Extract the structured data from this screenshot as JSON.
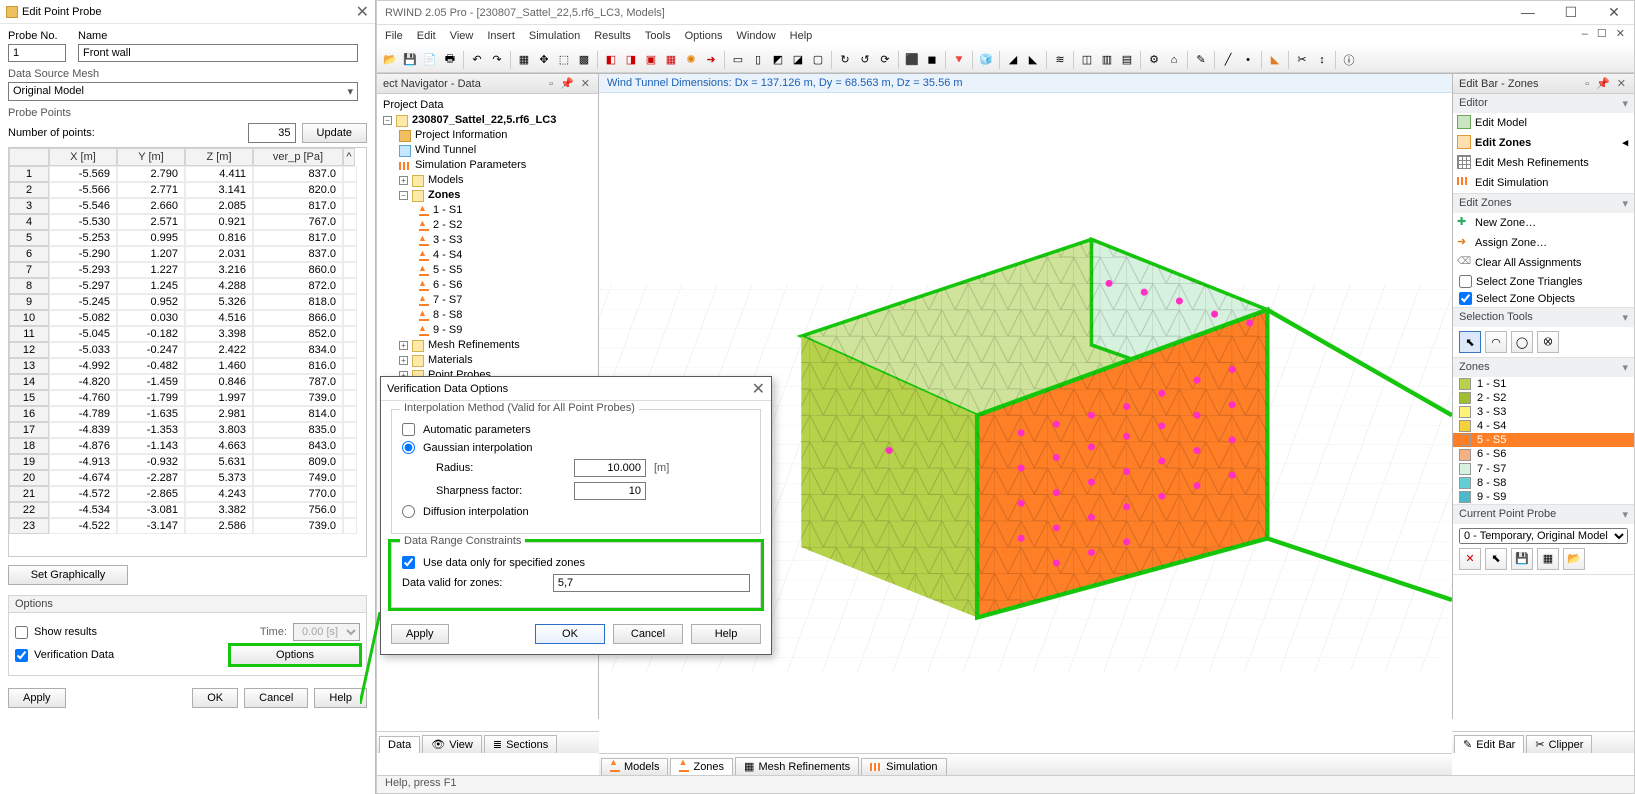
{
  "main": {
    "title": "RWIND 2.05 Pro - [230807_Sattel_22,5.rf6_LC3, Models]",
    "menus": [
      "File",
      "Edit",
      "View",
      "Insert",
      "Simulation",
      "Results",
      "Tools",
      "Options",
      "Window",
      "Help"
    ],
    "banner": "Wind Tunnel Dimensions: Dx = 137.126 m, Dy = 68.563 m, Dz = 35.56 m",
    "status": "Help, press F1"
  },
  "navigator": {
    "title": "ect Navigator - Data",
    "project_header": "Project Data",
    "root": "230807_Sattel_22,5.rf6_LC3",
    "items": [
      "Project Information",
      "Wind Tunnel",
      "Simulation Parameters",
      "Models",
      "Zones"
    ],
    "zones": [
      "1 - S1",
      "2 - S2",
      "3 - S3",
      "4 - S4",
      "5 - S5",
      "6 - S6",
      "7 - S7",
      "8 - S8",
      "9 - S9"
    ],
    "tail": [
      "Mesh Refinements",
      "Materials",
      "Point Probes"
    ],
    "bottom_tabs": [
      "Data",
      "View",
      "Sections"
    ]
  },
  "viewport_tabs": [
    "Models",
    "Zones",
    "Mesh Refinements",
    "Simulation"
  ],
  "editbar": {
    "title": "Edit Bar - Zones",
    "editor_title": "Editor",
    "editor": [
      "Edit Model",
      "Edit Zones",
      "Edit Mesh Refinements",
      "Edit Simulation"
    ],
    "zones_title": "Edit Zones",
    "zone_actions": [
      "New Zone…",
      "Assign Zone…",
      "Clear All Assignments"
    ],
    "zone_checks": [
      "Select Zone Triangles",
      "Select Zone Objects"
    ],
    "sel_title": "Selection Tools",
    "zl_title": "Zones",
    "zone_list": [
      {
        "label": "1 - S1",
        "color": "#b6d24b"
      },
      {
        "label": "2 - S2",
        "color": "#9fbf2e"
      },
      {
        "label": "3 - S3",
        "color": "#fff27a"
      },
      {
        "label": "4 - S4",
        "color": "#f5d23a"
      },
      {
        "label": "5 - S5",
        "color": "#ff7f27"
      },
      {
        "label": "6 - S6",
        "color": "#f4b183"
      },
      {
        "label": "7 - S7",
        "color": "#d6f1de"
      },
      {
        "label": "8 - S8",
        "color": "#61d0d4"
      },
      {
        "label": "9 - S9",
        "color": "#4bb9c9"
      }
    ],
    "probe_title": "Current Point Probe",
    "probe_value": "0 - Temporary, Original Model",
    "bottom_tabs": [
      "Edit Bar",
      "Clipper"
    ]
  },
  "probe_dlg": {
    "title": "Edit Point Probe",
    "no_lbl": "Probe No.",
    "no_val": "1",
    "name_lbl": "Name",
    "name_val": "Front wall",
    "src_lbl": "Data Source Mesh",
    "src_val": "Original Model",
    "pts_lbl": "Probe Points",
    "numpts_lbl": "Number of points:",
    "numpts_val": "35",
    "update": "Update",
    "cols": [
      "",
      "X [m]",
      "Y [m]",
      "Z [m]",
      "ver_p [Pa]",
      "^"
    ],
    "rows": [
      [
        "1",
        "-5.569",
        "2.790",
        "4.411",
        "837.0"
      ],
      [
        "2",
        "-5.566",
        "2.771",
        "3.141",
        "820.0"
      ],
      [
        "3",
        "-5.546",
        "2.660",
        "2.085",
        "817.0"
      ],
      [
        "4",
        "-5.530",
        "2.571",
        "0.921",
        "767.0"
      ],
      [
        "5",
        "-5.253",
        "0.995",
        "0.816",
        "817.0"
      ],
      [
        "6",
        "-5.290",
        "1.207",
        "2.031",
        "837.0"
      ],
      [
        "7",
        "-5.293",
        "1.227",
        "3.216",
        "860.0"
      ],
      [
        "8",
        "-5.297",
        "1.245",
        "4.288",
        "872.0"
      ],
      [
        "9",
        "-5.245",
        "0.952",
        "5.326",
        "818.0"
      ],
      [
        "10",
        "-5.082",
        "0.030",
        "4.516",
        "866.0"
      ],
      [
        "11",
        "-5.045",
        "-0.182",
        "3.398",
        "852.0"
      ],
      [
        "12",
        "-5.033",
        "-0.247",
        "2.422",
        "834.0"
      ],
      [
        "13",
        "-4.992",
        "-0.482",
        "1.460",
        "816.0"
      ],
      [
        "14",
        "-4.820",
        "-1.459",
        "0.846",
        "787.0"
      ],
      [
        "15",
        "-4.760",
        "-1.799",
        "1.997",
        "739.0"
      ],
      [
        "16",
        "-4.789",
        "-1.635",
        "2.981",
        "814.0"
      ],
      [
        "17",
        "-4.839",
        "-1.353",
        "3.803",
        "835.0"
      ],
      [
        "18",
        "-4.876",
        "-1.143",
        "4.663",
        "843.0"
      ],
      [
        "19",
        "-4.913",
        "-0.932",
        "5.631",
        "809.0"
      ],
      [
        "20",
        "-4.674",
        "-2.287",
        "5.373",
        "749.0"
      ],
      [
        "21",
        "-4.572",
        "-2.865",
        "4.243",
        "770.0"
      ],
      [
        "22",
        "-4.534",
        "-3.081",
        "3.382",
        "756.0"
      ],
      [
        "23",
        "-4.522",
        "-3.147",
        "2.586",
        "739.0"
      ]
    ],
    "set_gr": "Set Graphically",
    "opt_title": "Options",
    "show_results": "Show results",
    "time_lbl": "Time:",
    "time_val": "0.00 [s]",
    "verif": "Verification Data",
    "options_btn": "Options",
    "foot": [
      "Apply",
      "OK",
      "Cancel",
      "Help"
    ]
  },
  "ver_dlg": {
    "title": "Verification Data Options",
    "fs1": "Interpolation Method (Valid for All Point Probes)",
    "auto": "Automatic parameters",
    "gauss": "Gaussian interpolation",
    "radius_lbl": "Radius:",
    "radius_val": "10.000",
    "radius_unit": "[m]",
    "sharp_lbl": "Sharpness factor:",
    "sharp_val": "10",
    "diff": "Diffusion interpolation",
    "fs2": "Data Range Constraints",
    "use_zones": "Use data only for specified zones",
    "valid_lbl": "Data valid for zones:",
    "valid_val": "5,7",
    "foot": [
      "Apply",
      "OK",
      "Cancel",
      "Help"
    ]
  }
}
